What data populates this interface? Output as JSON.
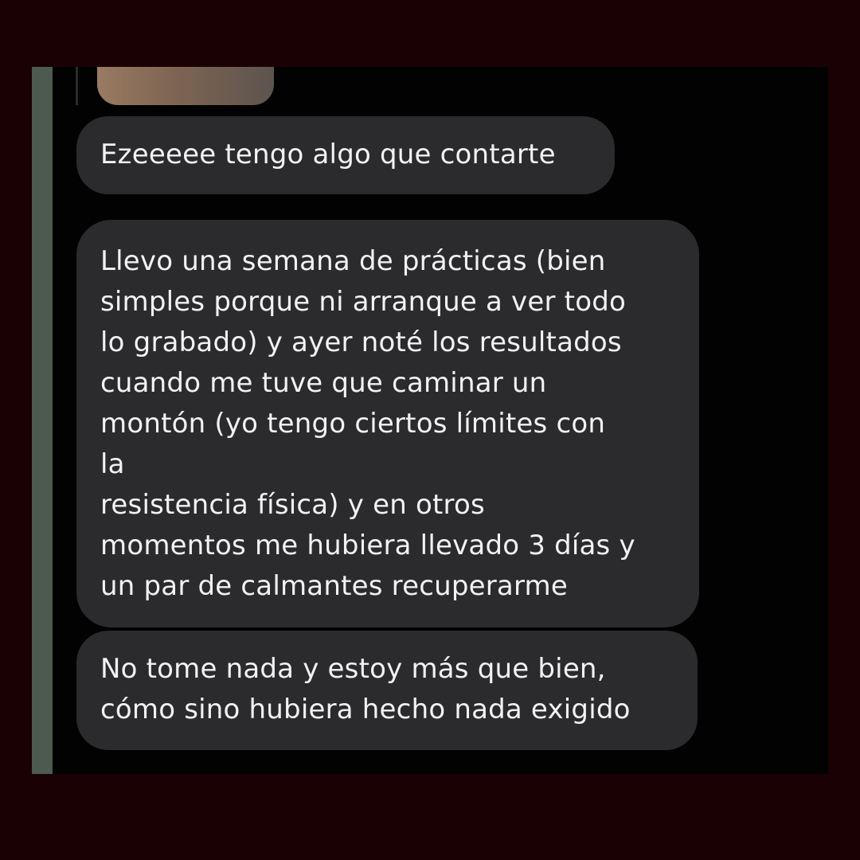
{
  "chat": {
    "messages": [
      {
        "lines": [
          "Ezeeeee tengo algo que contarte"
        ]
      },
      {
        "lines": [
          "Llevo una semana de prácticas (bien",
          "simples porque ni arranque a ver todo",
          "lo grabado) y ayer noté los resultados",
          "cuando me tuve que caminar un",
          "montón (yo tengo ciertos límites con",
          "la",
          "resistencia física) y en otros",
          "momentos me hubiera llevado 3 días y",
          "un par de calmantes recuperarme"
        ]
      },
      {
        "lines": [
          "No tome nada y estoy más que bien,",
          "cómo sino hubiera hecho nada exigido"
        ]
      }
    ]
  },
  "colors": {
    "outer_background": "#1a0204",
    "screen_background": "#020202",
    "bubble": "#2b2b2d",
    "text": "#f2f2f2"
  }
}
